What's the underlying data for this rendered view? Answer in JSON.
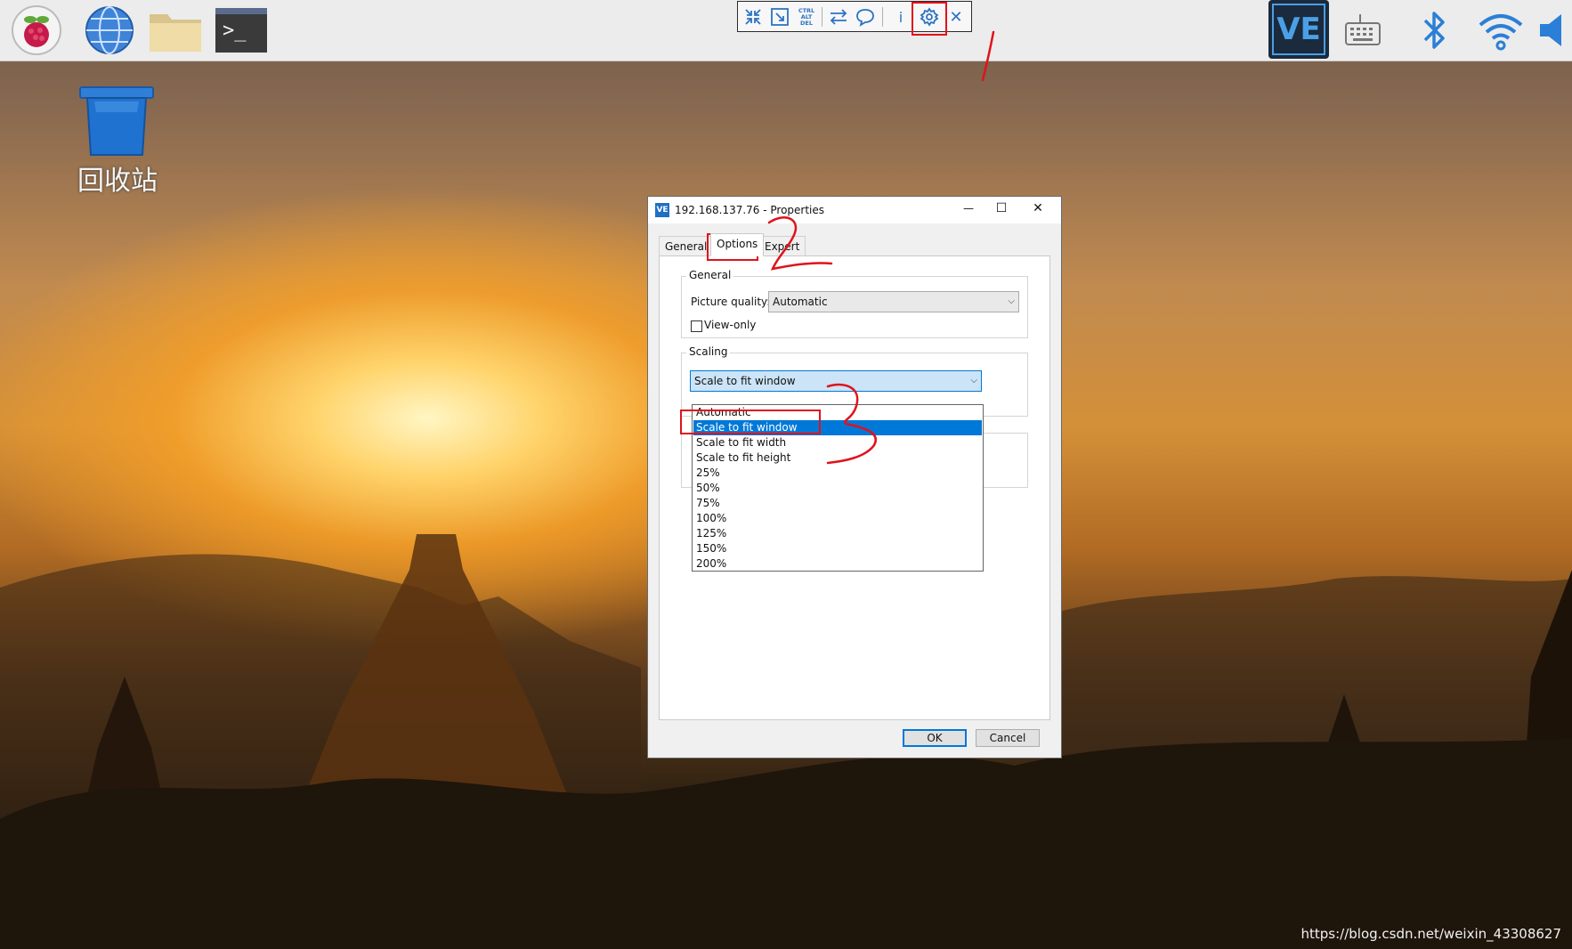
{
  "taskbar": {
    "left_icons": [
      "raspberry-pi-menu-icon",
      "web-browser-icon",
      "file-manager-icon",
      "terminal-icon"
    ],
    "right_icons": [
      "vnc-server-icon",
      "keyboard-icon",
      "bluetooth-icon",
      "wifi-icon",
      "volume-icon"
    ],
    "terminal_glyph": ">_",
    "vnc_logo_text": "VE"
  },
  "vnc_toolbar": {
    "icons": [
      "exit-fullscreen-icon",
      "scale-icon",
      "ctrl-alt-del-icon",
      "transfer-files-icon",
      "chat-icon",
      "info-icon",
      "settings-icon",
      "close-icon"
    ],
    "ctrl_alt_del_label": "CTRL ALT DEL",
    "info_glyph": "i",
    "close_glyph": "✕"
  },
  "desktop": {
    "trash_label": "回收站"
  },
  "dialog": {
    "title": "192.168.137.76 - Properties",
    "window_controls": {
      "minimize": "—",
      "maximize": "☐",
      "close": "✕"
    },
    "tabs": [
      {
        "label": "General",
        "active": false
      },
      {
        "label": "Options",
        "active": true
      },
      {
        "label": "Expert",
        "active": false
      }
    ],
    "general_group": {
      "title": "General",
      "picture_quality_label": "Picture quality:",
      "picture_quality_value": "Automatic",
      "view_only_label": "View-only",
      "view_only_checked": false
    },
    "scaling_group": {
      "title": "Scaling",
      "selected_value": "Scale to fit window",
      "options": [
        "Automatic",
        "Scale to fit window",
        "Scale to fit width",
        "Scale to fit height",
        "25%",
        "50%",
        "75%",
        "100%",
        "125%",
        "150%",
        "200%"
      ],
      "highlighted_index": 1
    },
    "buttons": {
      "ok": "OK",
      "cancel": "Cancel"
    }
  },
  "annotations": {
    "step_marks": [
      "1",
      "2",
      "3"
    ],
    "color": "#e1121b"
  },
  "watermark": "https://blog.csdn.net/weixin_43308627",
  "colors": {
    "selection": "#0078d7",
    "annotation_red": "#e1121b",
    "vnc_blue": "#2d72c4"
  }
}
